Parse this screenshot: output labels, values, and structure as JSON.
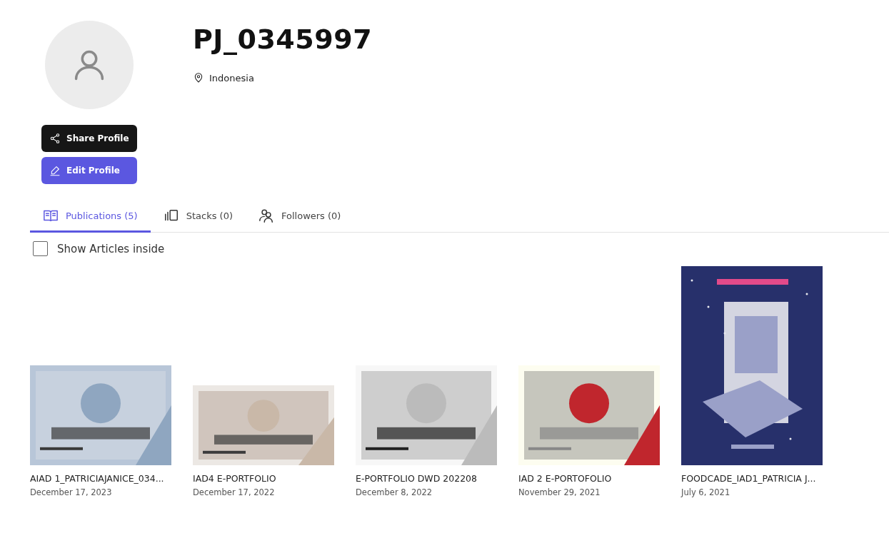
{
  "profile": {
    "name": "PJ_0345997",
    "location": "Indonesia"
  },
  "buttons": [
    {
      "kind": "share",
      "label": "Share Profile"
    },
    {
      "kind": "edit",
      "label": "Edit Profile"
    }
  ],
  "tabs": [
    {
      "kind": "publications",
      "label": "Publications (5)",
      "selected": true
    },
    {
      "kind": "stacks",
      "label": "Stacks (0)",
      "selected": false
    },
    {
      "kind": "followers",
      "label": "Followers (0)",
      "selected": false
    }
  ],
  "filter": {
    "label": "Show Articles inside",
    "checked": false
  },
  "publications": [
    {
      "title": "AIAD 1_PATRICIAJANICE_034...",
      "date": "December 17, 2023"
    },
    {
      "title": "IAD4 E-PORTFOLIO",
      "date": "December 17, 2022"
    },
    {
      "title": "E-PORTFOLIO DWD 202208",
      "date": "December 8, 2022"
    },
    {
      "title": "IAD 2 E-PORTOFOLIO",
      "date": "November 29, 2021"
    },
    {
      "title": "FOODCADE_IAD1_PATRICIA J...",
      "date": "July 6, 2021"
    }
  ]
}
